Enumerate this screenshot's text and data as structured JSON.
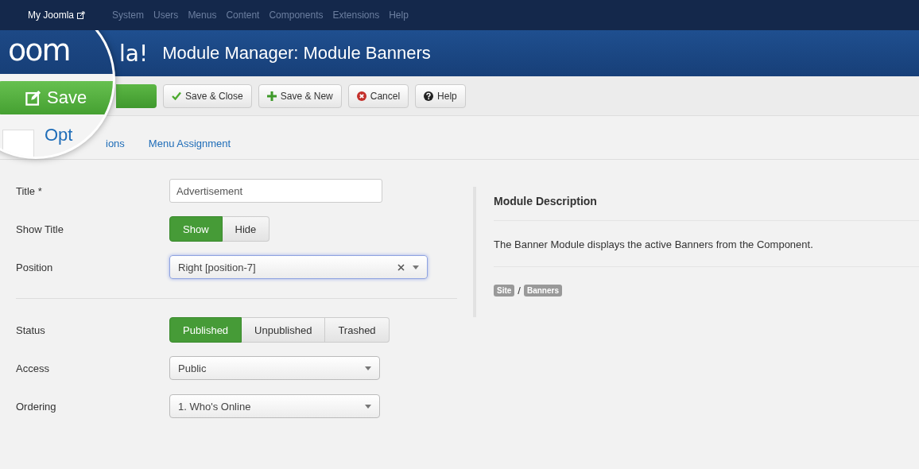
{
  "top_menu": {
    "brand": "My Joomla",
    "items": [
      {
        "label": "System"
      },
      {
        "label": "Users"
      },
      {
        "label": "Menus"
      },
      {
        "label": "Content"
      },
      {
        "label": "Components"
      },
      {
        "label": "Extensions"
      },
      {
        "label": "Help"
      }
    ]
  },
  "header": {
    "logo_fragment": "la!",
    "title": "Module Manager: Module Banners"
  },
  "toolbar": {
    "buttons": [
      {
        "kind": "save-close",
        "label": "Save & Close"
      },
      {
        "kind": "save-new",
        "label": "Save & New"
      },
      {
        "kind": "cancel",
        "label": "Cancel"
      },
      {
        "kind": "help",
        "label": "Help"
      }
    ]
  },
  "magnifier": {
    "logo_fragment": "oom",
    "save_label": "Save",
    "tab_fragment": "Opt"
  },
  "tabs": [
    {
      "label": "ions",
      "selected": false
    },
    {
      "label": "Menu Assignment",
      "selected": false
    }
  ],
  "form": {
    "groups": [
      {
        "rows": [
          {
            "kind": "text",
            "label": "Title *",
            "value": "Advertisement"
          },
          {
            "kind": "toggle",
            "label": "Show Title",
            "options": [
              {
                "label": "Show",
                "selected": true
              },
              {
                "label": "Hide",
                "selected": false
              }
            ]
          },
          {
            "kind": "select",
            "label": "Position",
            "value": "Right [position-7]",
            "clearable": true,
            "focused": true
          }
        ]
      },
      {
        "rows": [
          {
            "kind": "toggle",
            "label": "Status",
            "options": [
              {
                "label": "Published",
                "selected": true
              },
              {
                "label": "Unpublished",
                "selected": false
              },
              {
                "label": "Trashed",
                "selected": false
              }
            ]
          },
          {
            "kind": "select",
            "label": "Access",
            "value": "Public",
            "clearable": false,
            "focused": false
          },
          {
            "kind": "select",
            "label": "Ordering",
            "value": "1. Who's Online",
            "clearable": false,
            "focused": false
          }
        ]
      }
    ]
  },
  "description": {
    "heading": "Module Description",
    "text": "The Banner Module displays the active Banners from the Component.",
    "badges": [
      {
        "label": "Site"
      },
      {
        "label": "Banners"
      }
    ],
    "separator": "/"
  }
}
